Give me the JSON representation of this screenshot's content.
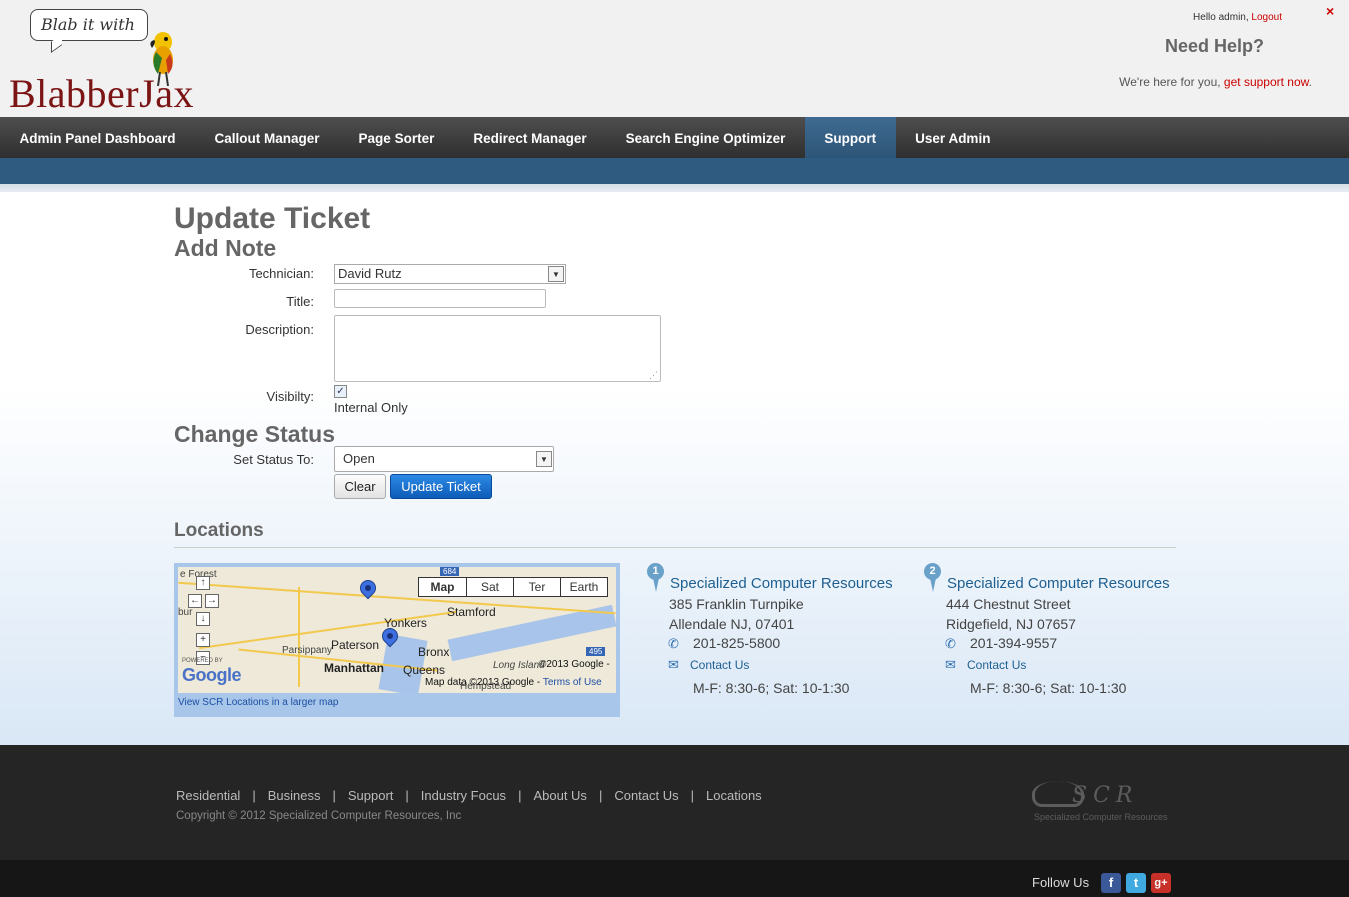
{
  "header": {
    "logo_tagline": "Blab it with",
    "logo_name": "BlabberJax",
    "greeting": "Hello admin, ",
    "logout": "Logout",
    "need_help": "Need Help?",
    "support_text": "We're here for you, ",
    "support_link": "get support now",
    "support_suffix": ".",
    "close": "×"
  },
  "nav": {
    "items": [
      "Admin Panel Dashboard",
      "Callout Manager",
      "Page Sorter",
      "Redirect Manager",
      "Search Engine Optimizer",
      "Support",
      "User Admin"
    ],
    "active": "Support"
  },
  "form": {
    "page_title": "Update Ticket",
    "add_note_heading": "Add Note",
    "technician_label": "Technician:",
    "technician_value": "David Rutz",
    "title_label": "Title:",
    "title_value": "",
    "description_label": "Description:",
    "description_value": "",
    "visibility_label": "Visibilty:",
    "visibility_checked": true,
    "visibility_option": "Internal Only",
    "change_status_heading": "Change Status",
    "status_label": "Set Status To:",
    "status_value": "Open",
    "clear_button": "Clear",
    "update_button": "Update Ticket"
  },
  "locations": {
    "heading": "Locations",
    "map": {
      "types": [
        "Map",
        "Sat",
        "Ter",
        "Earth"
      ],
      "places": [
        "e Forest",
        "bur",
        "Parsippany",
        "Paterson",
        "Yonkers",
        "Stamford",
        "Manhattan",
        "Bronx",
        "Queens",
        "Long Island",
        "Hempstead"
      ],
      "highways": [
        "684",
        "495"
      ],
      "copyright": "©2013 Google -",
      "map_data": "Map data ©2013 Google -",
      "terms": "Terms of Use",
      "google": "Google",
      "powered": "POWERED BY",
      "larger_map": "View SCR Locations in a larger map"
    },
    "offices": [
      {
        "number": "1",
        "name": "Specialized Computer Resources",
        "street": "385 Franklin Turnpike",
        "city": "Allendale NJ, 07401",
        "phone": "201-825-5800",
        "contact": "Contact Us",
        "hours": "M-F: 8:30-6; Sat: 10-1:30"
      },
      {
        "number": "2",
        "name": "Specialized Computer Resources",
        "street": "444 Chestnut Street",
        "city": "Ridgefield, NJ 07657",
        "phone": "201-394-9557",
        "contact": "Contact Us",
        "hours": "M-F: 8:30-6; Sat: 10-1:30"
      }
    ]
  },
  "footer": {
    "links": [
      "Residential",
      "Business",
      "Support",
      "Industry Focus",
      "About Us",
      "Contact Us",
      "Locations"
    ],
    "copyright": "Copyright © 2012 Specialized Computer Resources, Inc",
    "scr_logo_text": "SCR",
    "scr_logo_sub": "Specialized Computer Resources",
    "follow_us": "Follow Us",
    "social": [
      {
        "name": "facebook",
        "glyph": "f",
        "color": "#3b5998"
      },
      {
        "name": "twitter",
        "glyph": "t",
        "color": "#3fa9e0"
      },
      {
        "name": "google-plus",
        "glyph": "g+",
        "color": "#c8312a"
      }
    ]
  },
  "colors": {
    "brand_red": "#7b1414",
    "link_red": "#cc0000",
    "nav_active": "#2d5577",
    "button_blue": "#0d5cb8"
  }
}
